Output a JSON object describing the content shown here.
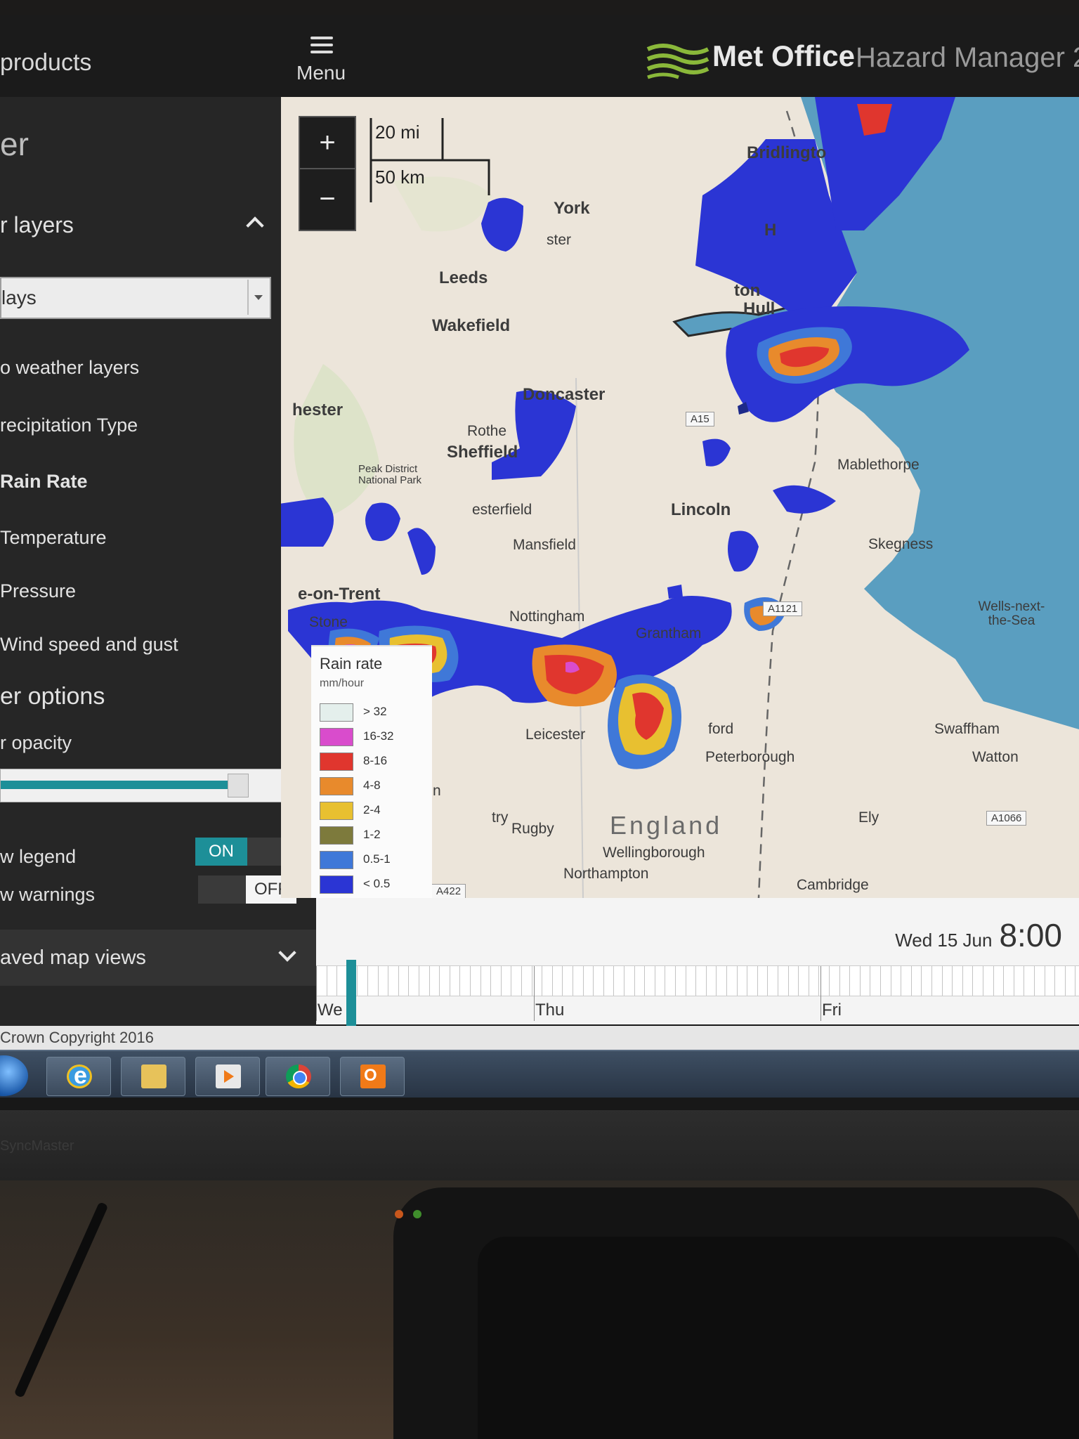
{
  "header": {
    "products_label": "products",
    "menu_label": "Menu",
    "brand": "Met Office",
    "product": "Hazard Manager 2"
  },
  "sidebar": {
    "section_title": "er",
    "layers_heading": "r layers",
    "overlay_select_value": "lays",
    "layers": [
      {
        "label": "o weather layers",
        "selected": false
      },
      {
        "label": "recipitation Type",
        "selected": false
      },
      {
        "label": "Rain Rate",
        "selected": true
      },
      {
        "label": "Temperature",
        "selected": false
      },
      {
        "label": "Pressure",
        "selected": false
      },
      {
        "label": "Wind speed and gust",
        "selected": false
      }
    ],
    "options_heading": "er options",
    "opacity_label": "r opacity",
    "opacity_fraction": 0.78,
    "show_legend_label": "w legend",
    "show_legend_state": "ON",
    "show_warnings_label": "w warnings",
    "show_warnings_state": "OFF",
    "saved_views_label": "aved map views"
  },
  "map": {
    "zoom_in": "+",
    "zoom_out": "−",
    "scale_miles": "20 mi",
    "scale_km": "50 km",
    "country": "England",
    "places": {
      "bridlington": "Bridlingto",
      "york": "York",
      "harrogate": "ster",
      "leeds": "Leeds",
      "wakefield": "Wakefield",
      "hull": "Hull",
      "kingston": "ton",
      "hornsea": "H",
      "doncaster": "Doncaster",
      "manchester": "hester",
      "rotherham": "Rothe",
      "sheffield": "Sheffield",
      "peak": "Peak District National Park",
      "chesterfield": "esterfield",
      "lincoln": "Lincoln",
      "mablethorpe": "Mablethorpe",
      "skegness": "Skegness",
      "mansfield": "Mansfield",
      "stoke": "e-on-Trent",
      "stone": "Stone",
      "nottingham": "Nottingham",
      "grantham": "Grantham",
      "wells": "Wells-next-the-Sea",
      "leicester": "Leicester",
      "stamford": "ford",
      "peterborough": "Peterborough",
      "swaffham": "Swaffham",
      "watton": "Watton",
      "ely": "Ely",
      "coventry": "try",
      "rugby": "Rugby",
      "wellingborough": "Wellingborough",
      "northampton": "Northampton",
      "cambridge": "Cambridge",
      "nuneaton": "n"
    },
    "roads": {
      "a15": "A15",
      "a1121": "A1121",
      "a1066": "A1066",
      "a422": "A422"
    },
    "legend": {
      "title": "Rain rate",
      "unit": "mm/hour",
      "items": [
        {
          "label": "> 32",
          "color": "#e4efec"
        },
        {
          "label": "16-32",
          "color": "#d94ccc"
        },
        {
          "label": "8-16",
          "color": "#e0362e"
        },
        {
          "label": "4-8",
          "color": "#e88a2c"
        },
        {
          "label": "2-4",
          "color": "#e8c030"
        },
        {
          "label": "1-2",
          "color": "#7d7a3c"
        },
        {
          "label": "0.5-1",
          "color": "#3f78d8"
        },
        {
          "label": "< 0.5",
          "color": "#2b35d4"
        }
      ]
    }
  },
  "timeline": {
    "date": "Wed 15 Jun",
    "time": "8:00",
    "days": [
      "We",
      "Thu",
      "Fri"
    ],
    "position_fraction": 0.04
  },
  "copyright": "Crown Copyright 2016",
  "taskbar": {
    "apps": [
      "internet-explorer-icon",
      "file-explorer-icon",
      "media-player-icon",
      "chrome-icon",
      "outlook-icon"
    ]
  },
  "bezel_text": "SyncMaster"
}
